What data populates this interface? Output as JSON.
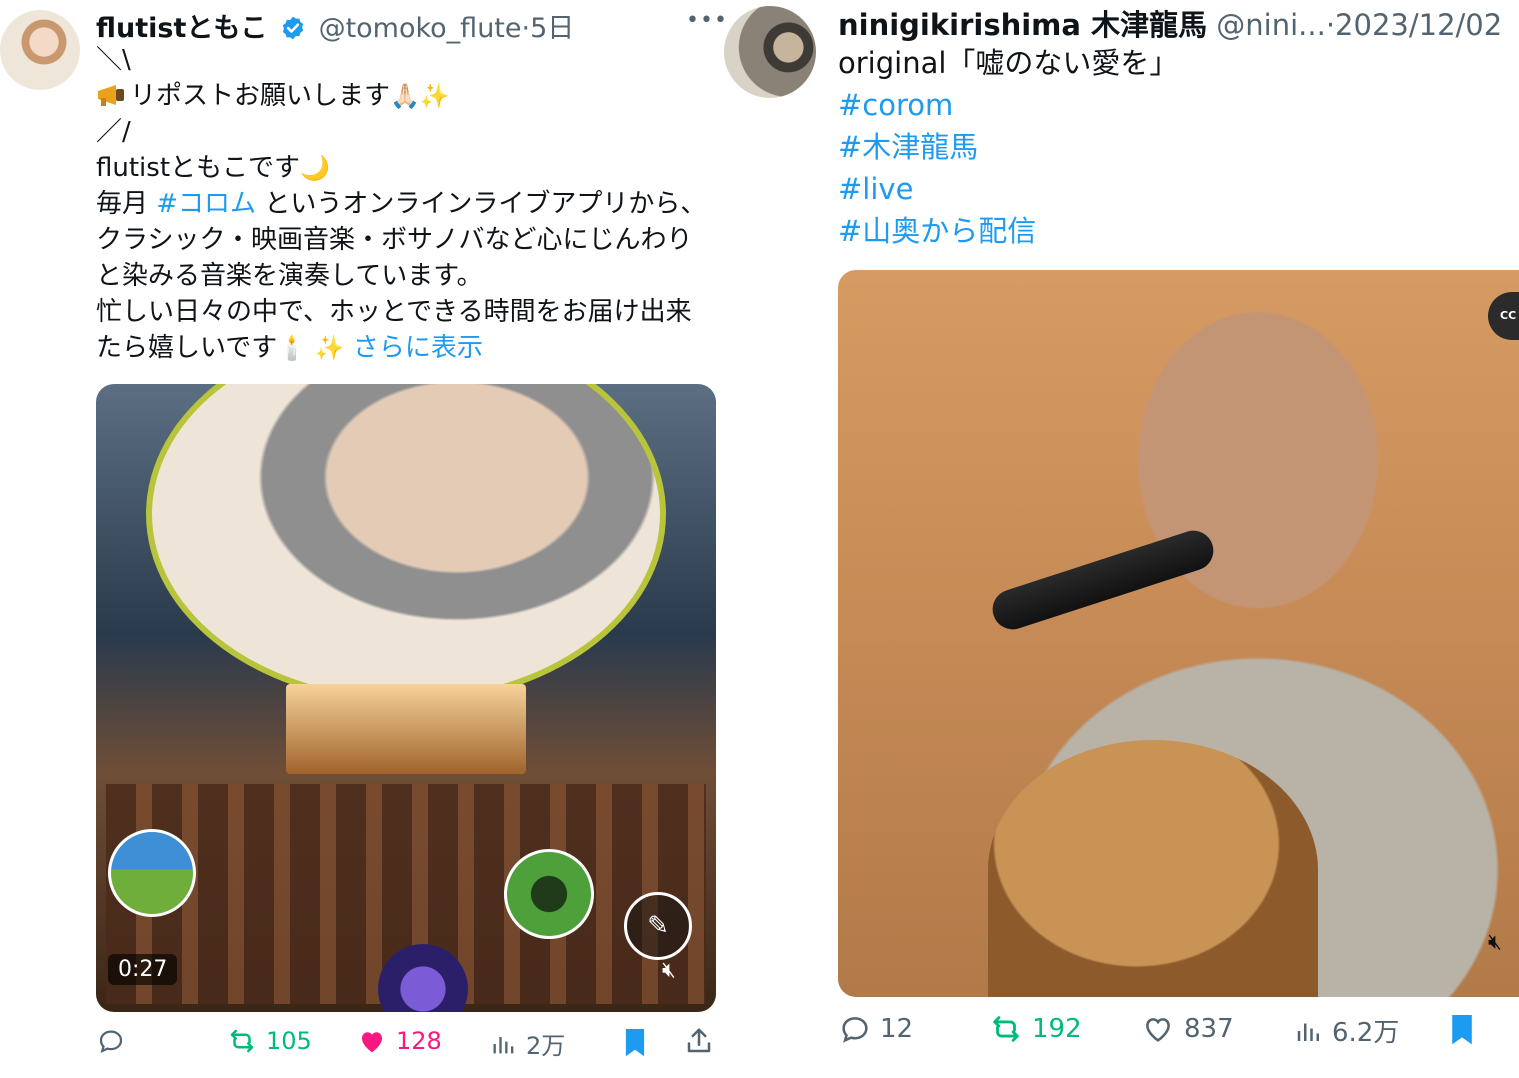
{
  "tweets": [
    {
      "display_name": "flutistともこ",
      "handle": "@tomoko_flute",
      "separator": "·",
      "date": "5日",
      "more_icon": "more-dots-icon",
      "lines": {
        "l1": "＼\\",
        "l2_icon": "megaphone-icon",
        "l2_text": "リポストお願いします",
        "l2_emoji": "🙏🏻✨",
        "l3": "／/",
        "l4_text": "flutistともこです",
        "l4_emoji": "🌙",
        "l5_pre": "毎月 ",
        "l5_tag": "#コロム",
        "l5_post": " というオンラインライブアプリから、",
        "l6": "クラシック・映画音楽・ボサノバなど心にじんわり",
        "l7": "と染みる音楽を演奏しています。",
        "l8": "忙しい日々の中で、ホッとできる時間をお届け出来",
        "l9_text": "たら嬉しいです",
        "l9_emoji": "🕯️ ✨",
        "show_more": "さらに表示"
      },
      "media": {
        "duration": "0:27",
        "mute_icon": "speaker-muted-icon"
      },
      "actions": {
        "reply": "",
        "retweet": "105",
        "like": "128",
        "views": "2万"
      },
      "colors": {
        "retweet": "#00ba7c",
        "like": "#f91880",
        "link": "#1d9bf0",
        "bookmark": "#1d9bf0"
      }
    },
    {
      "display_name": "ninigikirishima 木津龍馬",
      "handle": "@nini...",
      "separator": "·",
      "date": "2023/12/02",
      "lines": {
        "l1": "original「嘘のない愛を」",
        "tag1": "#corom",
        "tag2": "#木津龍馬",
        "tag3": "#live",
        "tag4": "#山奥から配信"
      },
      "media": {
        "cc": "CC",
        "mute_icon": "speaker-muted-icon"
      },
      "actions": {
        "reply": "12",
        "retweet": "192",
        "like": "837",
        "views": "6.2万"
      },
      "colors": {
        "retweet": "#00ba7c",
        "link": "#1d9bf0",
        "bookmark": "#1d9bf0"
      }
    }
  ]
}
